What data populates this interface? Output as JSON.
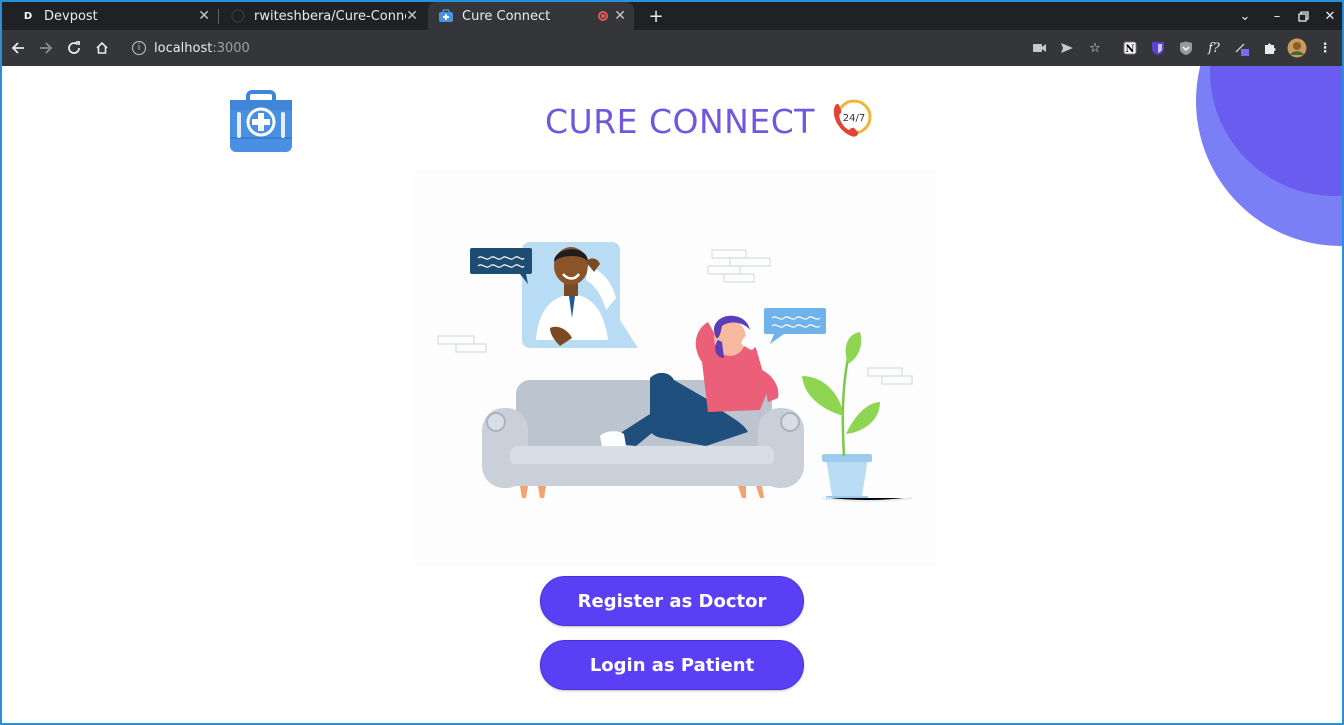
{
  "browser": {
    "tabs": [
      {
        "label": "Devpost",
        "favicon": "D",
        "active": false
      },
      {
        "label": "rwiteshbera/Cure-Connec",
        "favicon": "",
        "active": false
      },
      {
        "label": "Cure Connect",
        "favicon": "",
        "active": true
      }
    ],
    "new_tab": "+",
    "address": {
      "host": "localhost",
      "port": ":3000"
    }
  },
  "page": {
    "title": "CURE CONNECT",
    "badge_text": "24/7",
    "buttons": {
      "register_doctor": "Register as Doctor",
      "login_patient": "Login as Patient"
    }
  },
  "colors": {
    "accent": "#5b3ff5",
    "title": "#7157de",
    "blob_outer": "#7b7ff5",
    "blob_inner": "#6b5cf0"
  }
}
